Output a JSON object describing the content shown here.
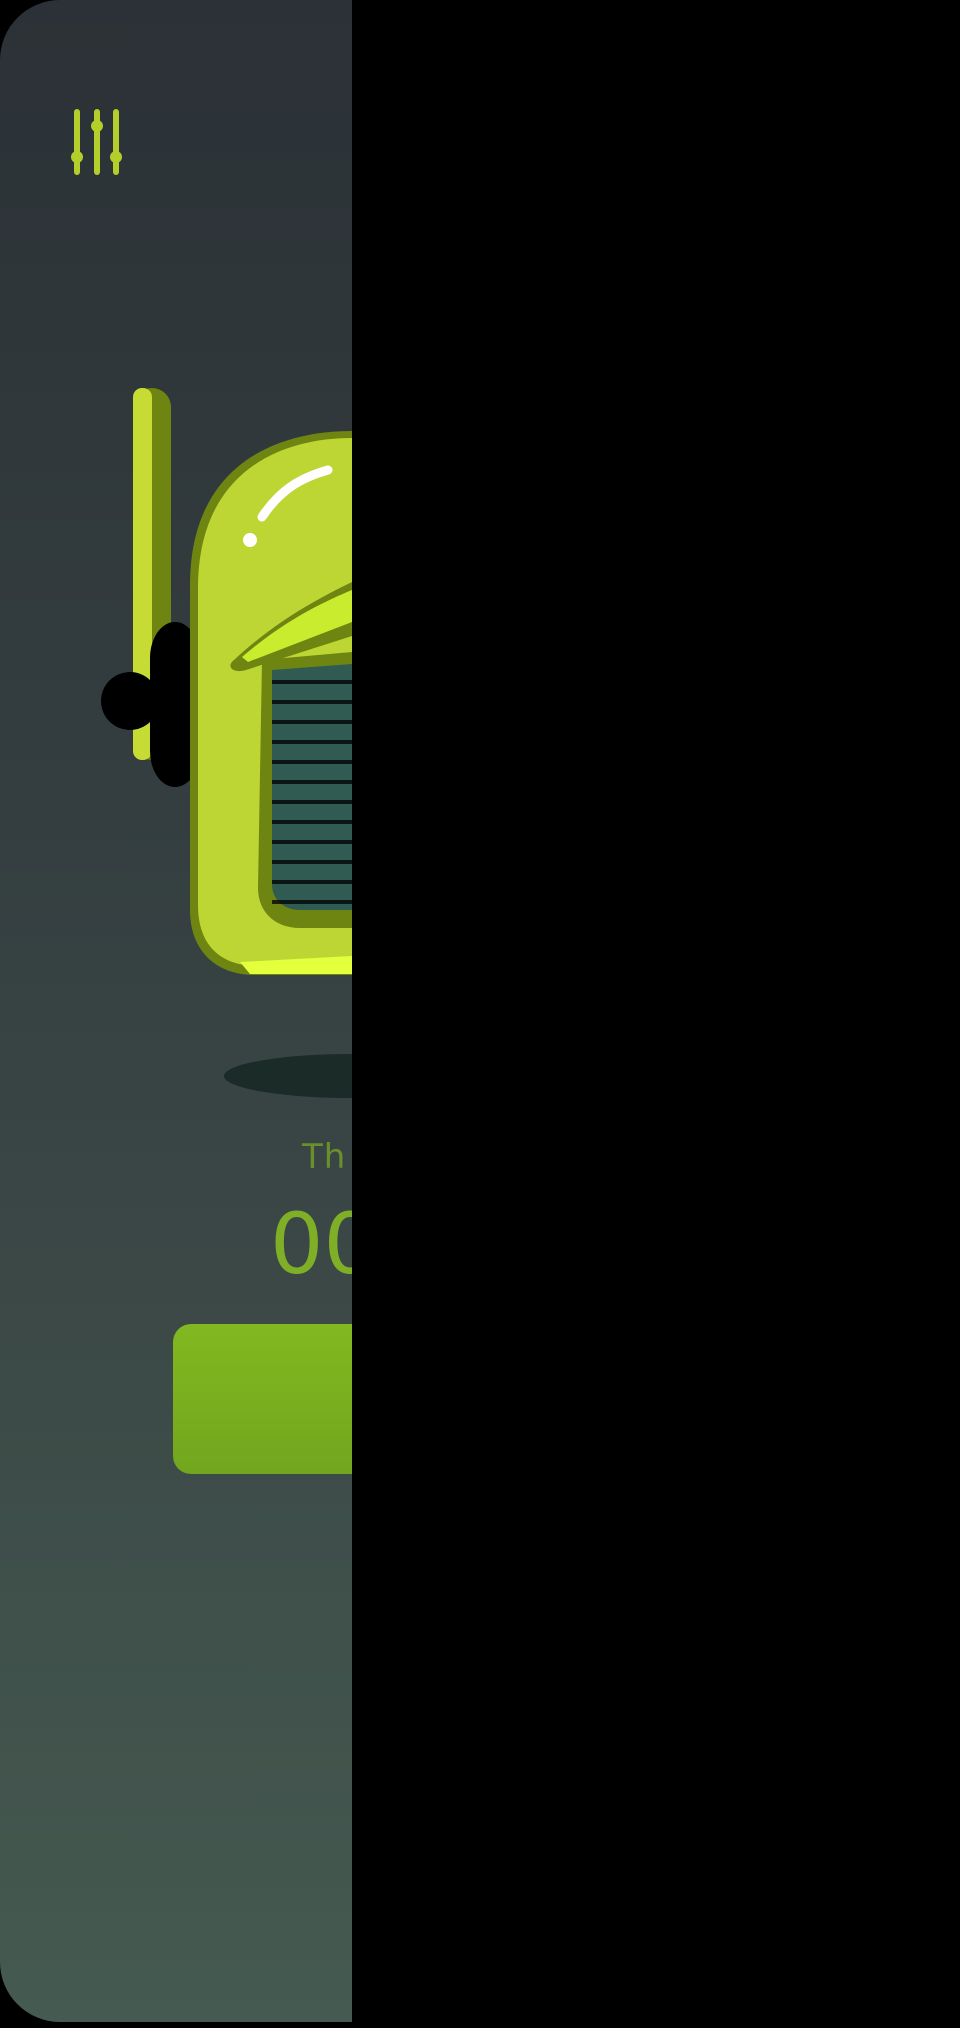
{
  "app": {
    "settings_icon": "sliders-icon",
    "illustration": "robot-head-illustration",
    "timer_label": "Th",
    "timer_value": "00",
    "start_button_label": ""
  },
  "colors": {
    "accent": "#b4cf2c",
    "accent_dark": "#6e8512",
    "button": "#7cb21f",
    "timer_text": "#7faf26",
    "background_top": "#2b3136",
    "background_bottom": "#455a50",
    "overlay": "#000000"
  }
}
